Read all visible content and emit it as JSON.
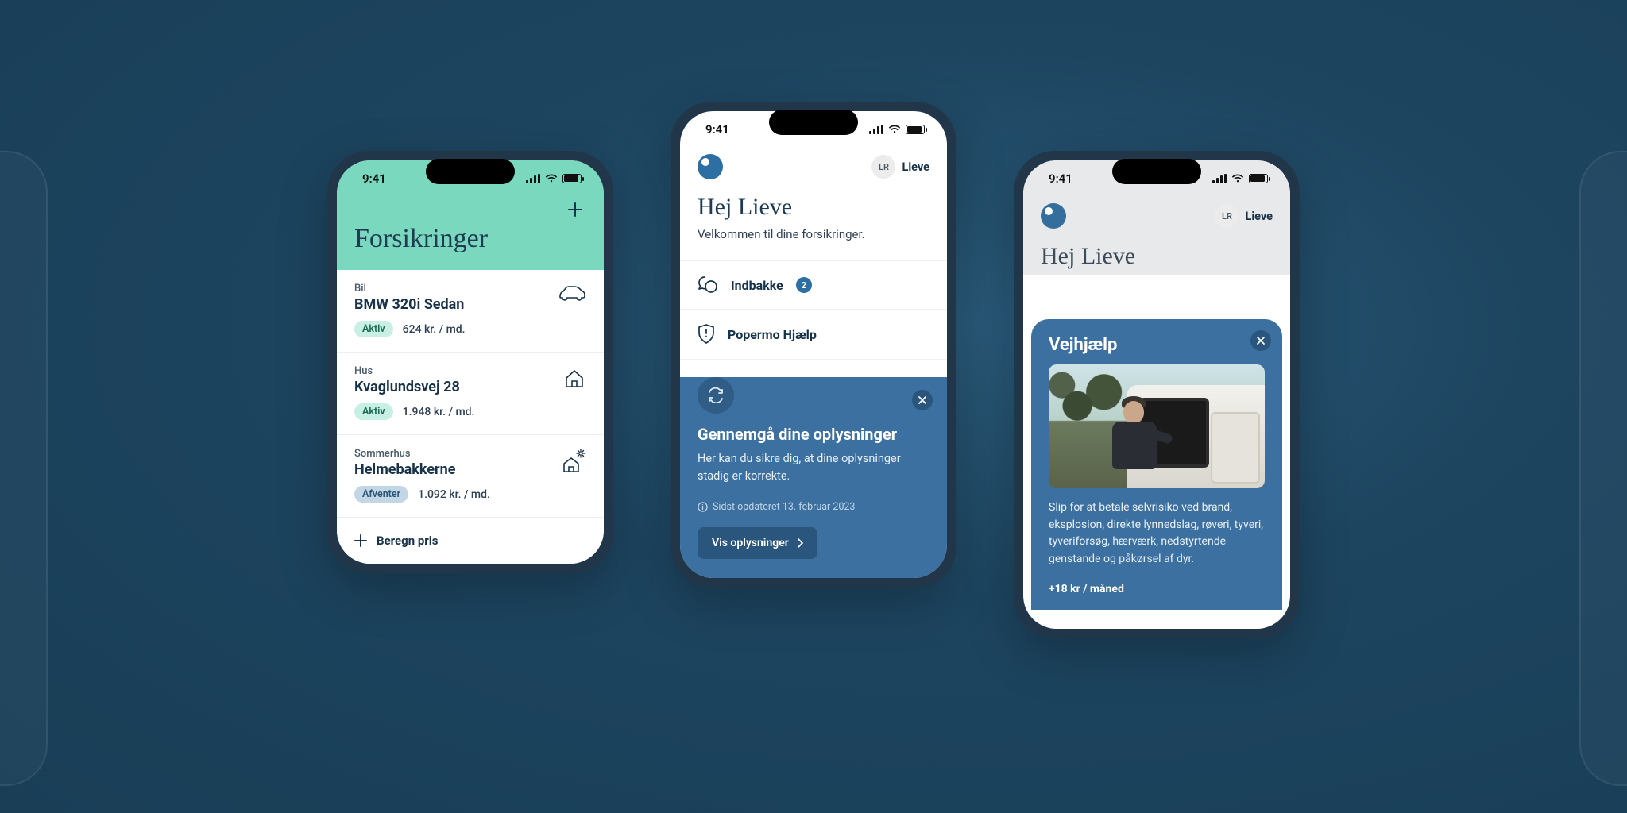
{
  "status_time": "9:41",
  "screen1": {
    "title": "Forsikringer",
    "items": [
      {
        "category": "Bil",
        "name": "BMW 320i Sedan",
        "status": "Aktiv",
        "status_kind": "green",
        "price": "624 kr. / md.",
        "icon": "car"
      },
      {
        "category": "Hus",
        "name": "Kvaglundsvej 28",
        "status": "Aktiv",
        "status_kind": "green",
        "price": "1.948 kr. / md.",
        "icon": "house"
      },
      {
        "category": "Sommerhus",
        "name": "Helmebakkerne",
        "status": "Afventer",
        "status_kind": "blue",
        "price": "1.092 kr. / md.",
        "icon": "summerhouse"
      }
    ],
    "calc_label": "Beregn pris"
  },
  "screen2": {
    "user_initials": "LR",
    "user_name": "Lieve",
    "greeting_title": "Hej Lieve",
    "greeting_sub": "Velkommen til dine forsikringer.",
    "inbox_label": "Indbakke",
    "inbox_count": "2",
    "help_label": "Popermo Hjælp",
    "card_title": "Gennemgå dine oplysninger",
    "card_body": "Her kan du sikre dig, at dine oplysninger stadig er korrekte.",
    "card_meta": "Sidst opdateret 13. februar 2023",
    "cta": "Vis oplysninger"
  },
  "screen3": {
    "user_initials": "LR",
    "user_name": "Lieve",
    "greeting_title": "Hej Lieve",
    "sheet_title": "Vejhjælp",
    "sheet_body": "Slip for at betale selvrisiko ved brand, eksplosion, direkte lynnedslag, røveri, tyveri, tyveriforsøg, hærværk, nedstyrtende genstande og påkørsel af dyr.",
    "month_price": "+18 kr / måned"
  }
}
